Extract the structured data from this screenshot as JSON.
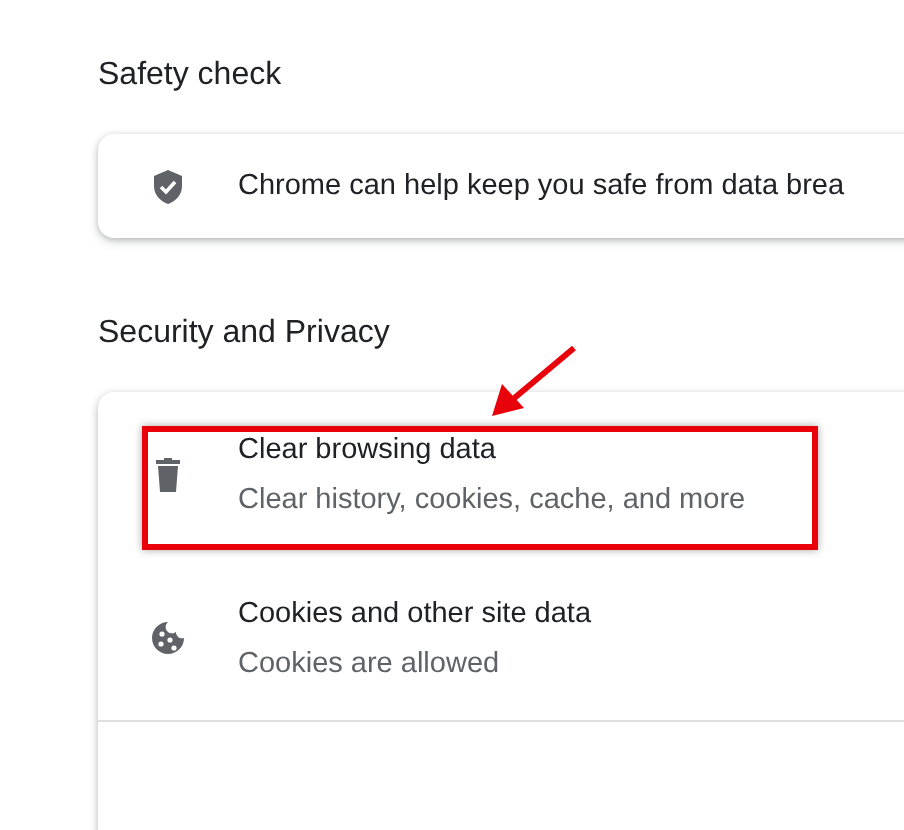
{
  "sections": [
    {
      "title": "Safety check",
      "items": [
        {
          "kind": "notice",
          "label": "Chrome can help keep you safe from data brea",
          "highlighted": false
        }
      ]
    },
    {
      "title": "Security and Privacy",
      "items": [
        {
          "kind": "link",
          "label": "Clear browsing data",
          "sublabel": "Clear history, cookies, cache, and more",
          "highlighted": true
        },
        {
          "kind": "link",
          "label": "Cookies and other site data",
          "sublabel": "Cookies are allowed",
          "highlighted": false
        }
      ]
    }
  ]
}
